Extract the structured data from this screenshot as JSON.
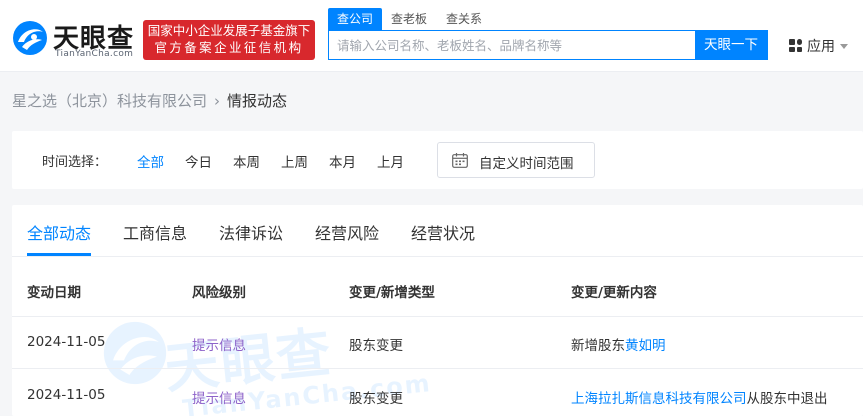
{
  "brand": {
    "logo_text": "天眼查",
    "logo_sub": "TianYanCha.com",
    "badge_line1": "国家中小企业发展子基金旗下",
    "badge_line2": "官方备案企业征信机构",
    "accent": "#0084ff",
    "badge_color": "#d8282d"
  },
  "search": {
    "tabs": [
      {
        "label": "查公司",
        "active": true
      },
      {
        "label": "查老板",
        "active": false
      },
      {
        "label": "查关系",
        "active": false
      }
    ],
    "placeholder": "请输入公司名称、老板姓名、品牌名称等",
    "button": "天眼一下"
  },
  "apps": {
    "label": "应用",
    "icon": "grid-icon"
  },
  "breadcrumb": {
    "company": "星之选（北京）科技有限公司",
    "separator": "›",
    "current": "情报动态"
  },
  "time_filter": {
    "label": "时间选择：",
    "options": [
      {
        "label": "全部",
        "active": true
      },
      {
        "label": "今日",
        "active": false
      },
      {
        "label": "本周",
        "active": false
      },
      {
        "label": "上周",
        "active": false
      },
      {
        "label": "本月",
        "active": false
      },
      {
        "label": "上月",
        "active": false
      }
    ],
    "custom_range": "自定义时间范围",
    "custom_icon": "calendar-icon"
  },
  "tabs": [
    {
      "label": "全部动态",
      "active": true
    },
    {
      "label": "工商信息",
      "active": false
    },
    {
      "label": "法律诉讼",
      "active": false
    },
    {
      "label": "经营风险",
      "active": false
    },
    {
      "label": "经营状况",
      "active": false
    }
  ],
  "table": {
    "headers": [
      "变动日期",
      "风险级别",
      "变更/新增类型",
      "变更/更新内容"
    ],
    "rows": [
      {
        "date": "2024-11-05",
        "risk": "提示信息",
        "type": "股东变更",
        "content_prefix": "新增股东",
        "content_link": "黄如明",
        "content_suffix": ""
      },
      {
        "date": "2024-11-05",
        "risk": "提示信息",
        "type": "股东变更",
        "content_prefix": "",
        "content_link": "上海拉扎斯信息科技有限公司",
        "content_suffix": "从股东中退出"
      }
    ]
  }
}
